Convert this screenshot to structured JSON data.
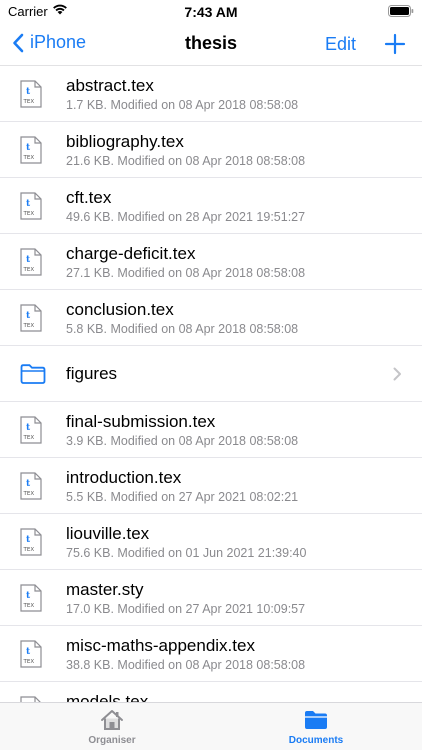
{
  "status_bar": {
    "carrier": "Carrier",
    "time": "7:43 AM"
  },
  "nav": {
    "back_label": "iPhone",
    "title": "thesis",
    "edit_label": "Edit"
  },
  "files": [
    {
      "name": "abstract.tex",
      "meta": "1.7 KB. Modified on 08 Apr 2018  08:58:08",
      "type": "tex"
    },
    {
      "name": "bibliography.tex",
      "meta": "21.6 KB. Modified on 08 Apr 2018  08:58:08",
      "type": "tex"
    },
    {
      "name": "cft.tex",
      "meta": "49.6 KB. Modified on 28 Apr 2021  19:51:27",
      "type": "tex"
    },
    {
      "name": "charge-deficit.tex",
      "meta": "27.1 KB. Modified on 08 Apr 2018  08:58:08",
      "type": "tex"
    },
    {
      "name": "conclusion.tex",
      "meta": "5.8 KB. Modified on 08 Apr 2018  08:58:08",
      "type": "tex"
    },
    {
      "name": "figures",
      "meta": "",
      "type": "folder"
    },
    {
      "name": "final-submission.tex",
      "meta": "3.9 KB. Modified on 08 Apr 2018  08:58:08",
      "type": "tex"
    },
    {
      "name": "introduction.tex",
      "meta": "5.5 KB. Modified on 27 Apr 2021  08:02:21",
      "type": "tex"
    },
    {
      "name": "liouville.tex",
      "meta": "75.6 KB. Modified on 01 Jun 2021  21:39:40",
      "type": "tex"
    },
    {
      "name": "master.sty",
      "meta": "17.0 KB. Modified on 27 Apr 2021  10:09:57",
      "type": "tex"
    },
    {
      "name": "misc-maths-appendix.tex",
      "meta": "38.8 KB. Modified on 08 Apr 2018  08:58:08",
      "type": "tex"
    },
    {
      "name": "models.tex",
      "meta": "",
      "type": "tex"
    }
  ],
  "file_icon_label": "TEX",
  "tabs": {
    "organiser": "Organiser",
    "documents": "Documents"
  },
  "colors": {
    "accent": "#1a7cf4",
    "inactive_tab": "#8e8e93"
  },
  "icons": {
    "back": "chevron-left-icon",
    "add": "plus-icon",
    "file": "tex-file-icon",
    "folder": "folder-icon",
    "disclosure": "chevron-right-icon",
    "organiser": "house-icon",
    "documents": "folder-fill-icon"
  }
}
